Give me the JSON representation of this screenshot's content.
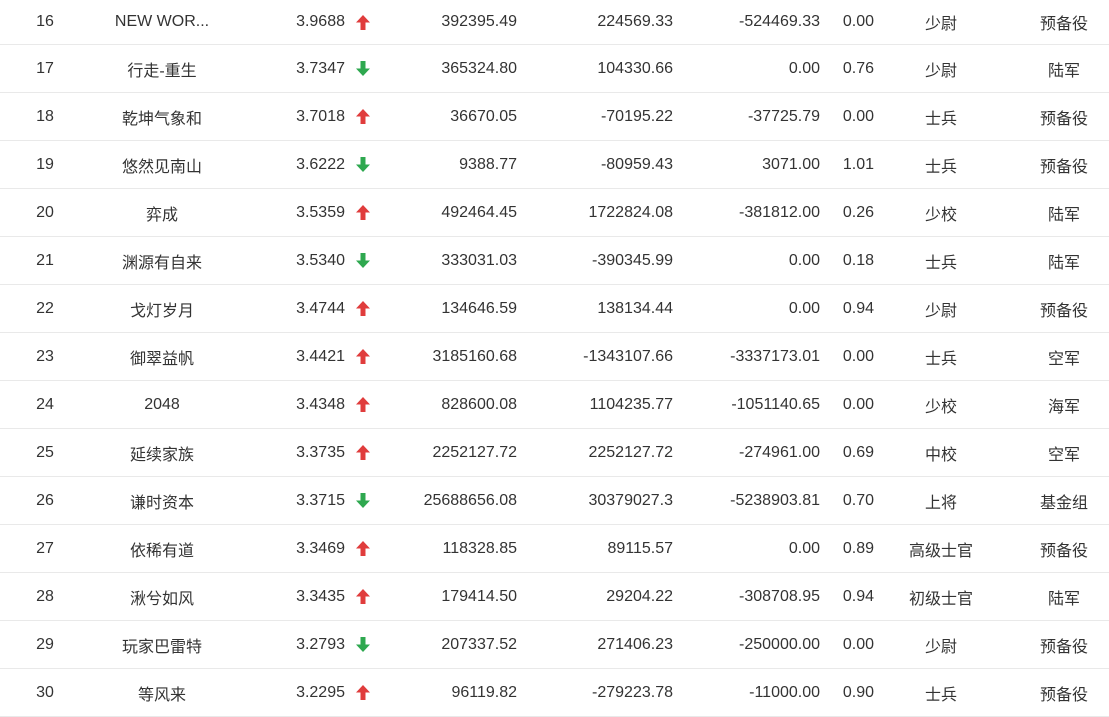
{
  "colors": {
    "up": "#e03c3c",
    "down": "#2ea84f"
  },
  "rows": [
    {
      "rank": "16",
      "name": "NEW WOR...",
      "score": "3.9688",
      "trend": "up",
      "v1": "392395.49",
      "v2": "224569.33",
      "v3": "-524469.33",
      "v4": "0.00",
      "title": "少尉",
      "army": "预备役"
    },
    {
      "rank": "17",
      "name": "行走-重生",
      "score": "3.7347",
      "trend": "down",
      "v1": "365324.80",
      "v2": "104330.66",
      "v3": "0.00",
      "v4": "0.76",
      "title": "少尉",
      "army": "陆军"
    },
    {
      "rank": "18",
      "name": "乾坤气象和",
      "score": "3.7018",
      "trend": "up",
      "v1": "36670.05",
      "v2": "-70195.22",
      "v3": "-37725.79",
      "v4": "0.00",
      "title": "士兵",
      "army": "预备役"
    },
    {
      "rank": "19",
      "name": "悠然见南山",
      "score": "3.6222",
      "trend": "down",
      "v1": "9388.77",
      "v2": "-80959.43",
      "v3": "3071.00",
      "v4": "1.01",
      "title": "士兵",
      "army": "预备役"
    },
    {
      "rank": "20",
      "name": "弈成",
      "score": "3.5359",
      "trend": "up",
      "v1": "492464.45",
      "v2": "1722824.08",
      "v3": "-381812.00",
      "v4": "0.26",
      "title": "少校",
      "army": "陆军"
    },
    {
      "rank": "21",
      "name": "渊源有自来",
      "score": "3.5340",
      "trend": "down",
      "v1": "333031.03",
      "v2": "-390345.99",
      "v3": "0.00",
      "v4": "0.18",
      "title": "士兵",
      "army": "陆军"
    },
    {
      "rank": "22",
      "name": "戈灯岁月",
      "score": "3.4744",
      "trend": "up",
      "v1": "134646.59",
      "v2": "138134.44",
      "v3": "0.00",
      "v4": "0.94",
      "title": "少尉",
      "army": "预备役"
    },
    {
      "rank": "23",
      "name": "御翠益帆",
      "score": "3.4421",
      "trend": "up",
      "v1": "3185160.68",
      "v2": "-1343107.66",
      "v3": "-3337173.01",
      "v4": "0.00",
      "title": "士兵",
      "army": "空军"
    },
    {
      "rank": "24",
      "name": "2048",
      "score": "3.4348",
      "trend": "up",
      "v1": "828600.08",
      "v2": "1104235.77",
      "v3": "-1051140.65",
      "v4": "0.00",
      "title": "少校",
      "army": "海军"
    },
    {
      "rank": "25",
      "name": "延续家族",
      "score": "3.3735",
      "trend": "up",
      "v1": "2252127.72",
      "v2": "2252127.72",
      "v3": "-274961.00",
      "v4": "0.69",
      "title": "中校",
      "army": "空军"
    },
    {
      "rank": "26",
      "name": "谦时资本",
      "score": "3.3715",
      "trend": "down",
      "v1": "25688656.08",
      "v2": "30379027.3",
      "v3": "-5238903.81",
      "v4": "0.70",
      "title": "上将",
      "army": "基金组"
    },
    {
      "rank": "27",
      "name": "依稀有道",
      "score": "3.3469",
      "trend": "up",
      "v1": "118328.85",
      "v2": "89115.57",
      "v3": "0.00",
      "v4": "0.89",
      "title": "高级士官",
      "army": "预备役"
    },
    {
      "rank": "28",
      "name": "湫兮如风",
      "score": "3.3435",
      "trend": "up",
      "v1": "179414.50",
      "v2": "29204.22",
      "v3": "-308708.95",
      "v4": "0.94",
      "title": "初级士官",
      "army": "陆军"
    },
    {
      "rank": "29",
      "name": "玩家巴雷特",
      "score": "3.2793",
      "trend": "down",
      "v1": "207337.52",
      "v2": "271406.23",
      "v3": "-250000.00",
      "v4": "0.00",
      "title": "少尉",
      "army": "预备役"
    },
    {
      "rank": "30",
      "name": "等风来",
      "score": "3.2295",
      "trend": "up",
      "v1": "96119.82",
      "v2": "-279223.78",
      "v3": "-11000.00",
      "v4": "0.90",
      "title": "士兵",
      "army": "预备役"
    }
  ]
}
